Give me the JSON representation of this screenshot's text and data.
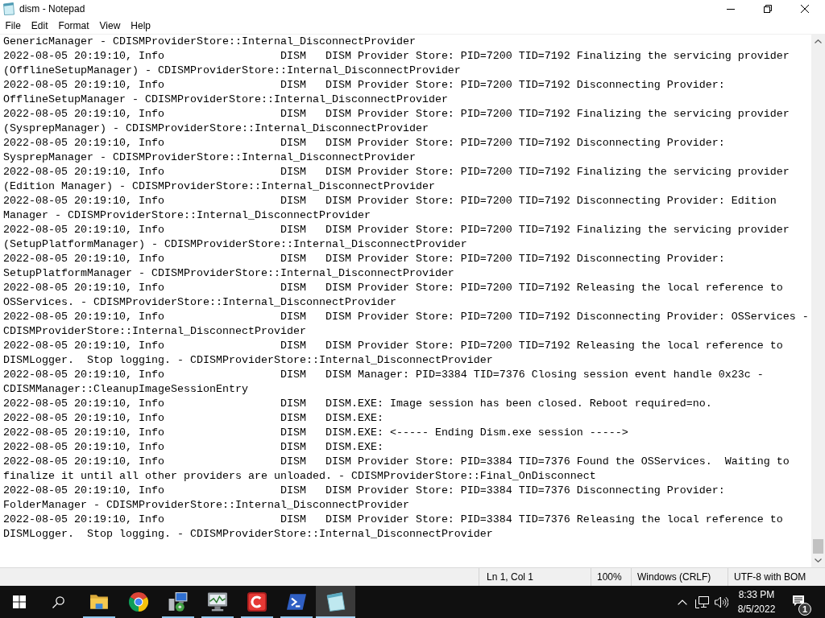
{
  "window": {
    "title": "dism - Notepad"
  },
  "menu": [
    "File",
    "Edit",
    "Format",
    "View",
    "Help"
  ],
  "document": {
    "lines": [
      "GenericManager - CDISMProviderStore::Internal_DisconnectProvider",
      "2022-08-05 20:19:10, Info                  DISM   DISM Provider Store: PID=7200 TID=7192 Finalizing the servicing provider (OfflineSetupManager) - CDISMProviderStore::Internal_DisconnectProvider",
      "2022-08-05 20:19:10, Info                  DISM   DISM Provider Store: PID=7200 TID=7192 Disconnecting Provider: OfflineSetupManager - CDISMProviderStore::Internal_DisconnectProvider",
      "2022-08-05 20:19:10, Info                  DISM   DISM Provider Store: PID=7200 TID=7192 Finalizing the servicing provider (SysprepManager) - CDISMProviderStore::Internal_DisconnectProvider",
      "2022-08-05 20:19:10, Info                  DISM   DISM Provider Store: PID=7200 TID=7192 Disconnecting Provider: SysprepManager - CDISMProviderStore::Internal_DisconnectProvider",
      "2022-08-05 20:19:10, Info                  DISM   DISM Provider Store: PID=7200 TID=7192 Finalizing the servicing provider (Edition Manager) - CDISMProviderStore::Internal_DisconnectProvider",
      "2022-08-05 20:19:10, Info                  DISM   DISM Provider Store: PID=7200 TID=7192 Disconnecting Provider: Edition Manager - CDISMProviderStore::Internal_DisconnectProvider",
      "2022-08-05 20:19:10, Info                  DISM   DISM Provider Store: PID=7200 TID=7192 Finalizing the servicing provider (SetupPlatformManager) - CDISMProviderStore::Internal_DisconnectProvider",
      "2022-08-05 20:19:10, Info                  DISM   DISM Provider Store: PID=7200 TID=7192 Disconnecting Provider: SetupPlatformManager - CDISMProviderStore::Internal_DisconnectProvider",
      "2022-08-05 20:19:10, Info                  DISM   DISM Provider Store: PID=7200 TID=7192 Releasing the local reference to OSServices. - CDISMProviderStore::Internal_DisconnectProvider",
      "2022-08-05 20:19:10, Info                  DISM   DISM Provider Store: PID=7200 TID=7192 Disconnecting Provider: OSServices - CDISMProviderStore::Internal_DisconnectProvider",
      "2022-08-05 20:19:10, Info                  DISM   DISM Provider Store: PID=7200 TID=7192 Releasing the local reference to DISMLogger.  Stop logging. - CDISMProviderStore::Internal_DisconnectProvider",
      "2022-08-05 20:19:10, Info                  DISM   DISM Manager: PID=3384 TID=7376 Closing session event handle 0x23c - CDISMManager::CleanupImageSessionEntry",
      "2022-08-05 20:19:10, Info                  DISM   DISM.EXE: Image session has been closed. Reboot required=no.",
      "2022-08-05 20:19:10, Info                  DISM   DISM.EXE:",
      "2022-08-05 20:19:10, Info                  DISM   DISM.EXE: <----- Ending Dism.exe session ----->",
      "2022-08-05 20:19:10, Info                  DISM   DISM.EXE:",
      "2022-08-05 20:19:10, Info                  DISM   DISM Provider Store: PID=3384 TID=7376 Found the OSServices.  Waiting to finalize it until all other providers are unloaded. - CDISMProviderStore::Final_OnDisconnect",
      "2022-08-05 20:19:10, Info                  DISM   DISM Provider Store: PID=3384 TID=7376 Disconnecting Provider: FolderManager - CDISMProviderStore::Internal_DisconnectProvider",
      "2022-08-05 20:19:10, Info                  DISM   DISM Provider Store: PID=3384 TID=7376 Releasing the local reference to DISMLogger.  Stop logging. - CDISMProviderStore::Internal_DisconnectProvider"
    ]
  },
  "status_bar": {
    "position": "Ln 1, Col 1",
    "zoom": "100%",
    "line_ending": "Windows (CRLF)",
    "encoding": "UTF-8 with BOM"
  },
  "taskbar": {
    "apps": [
      {
        "kind": "folder",
        "running": true,
        "selected": false
      },
      {
        "kind": "browser",
        "running": false,
        "selected": false
      },
      {
        "kind": "setup",
        "running": true,
        "selected": false
      },
      {
        "kind": "monitor",
        "running": true,
        "selected": false
      },
      {
        "kind": "red-c",
        "running": true,
        "selected": false
      },
      {
        "kind": "shell",
        "running": true,
        "selected": false
      },
      {
        "kind": "notepad",
        "running": true,
        "selected": true
      }
    ],
    "tray": {
      "time": "8:33 PM",
      "date": "8/5/2022",
      "notifications": "1"
    }
  }
}
